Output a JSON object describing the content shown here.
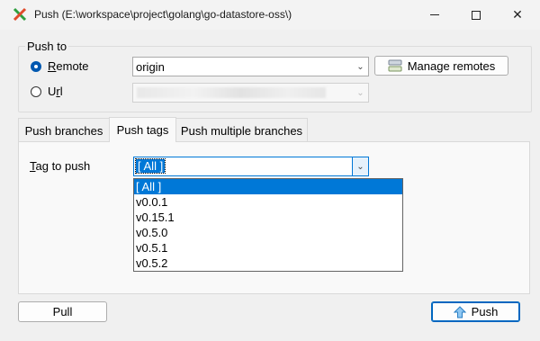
{
  "window": {
    "title": "Push (E:\\workspace\\project\\golang\\go-datastore-oss\\)"
  },
  "push_to": {
    "group_label": "Push to",
    "remote_label": "Remote",
    "remote_value": "origin",
    "url_label": "Url",
    "manage_remotes_label": "Manage remotes"
  },
  "tabs": [
    {
      "label": "Push branches"
    },
    {
      "label": "Push tags"
    },
    {
      "label": "Push multiple branches"
    }
  ],
  "tag_panel": {
    "tag_label": "Tag to push",
    "selected_value": "[ All ]",
    "options": [
      "[ All ]",
      "v0.0.1",
      "v0.15.1",
      "v0.5.0",
      "v0.5.1",
      "v0.5.2"
    ]
  },
  "buttons": {
    "pull_label": "Pull",
    "push_label": "Push"
  }
}
